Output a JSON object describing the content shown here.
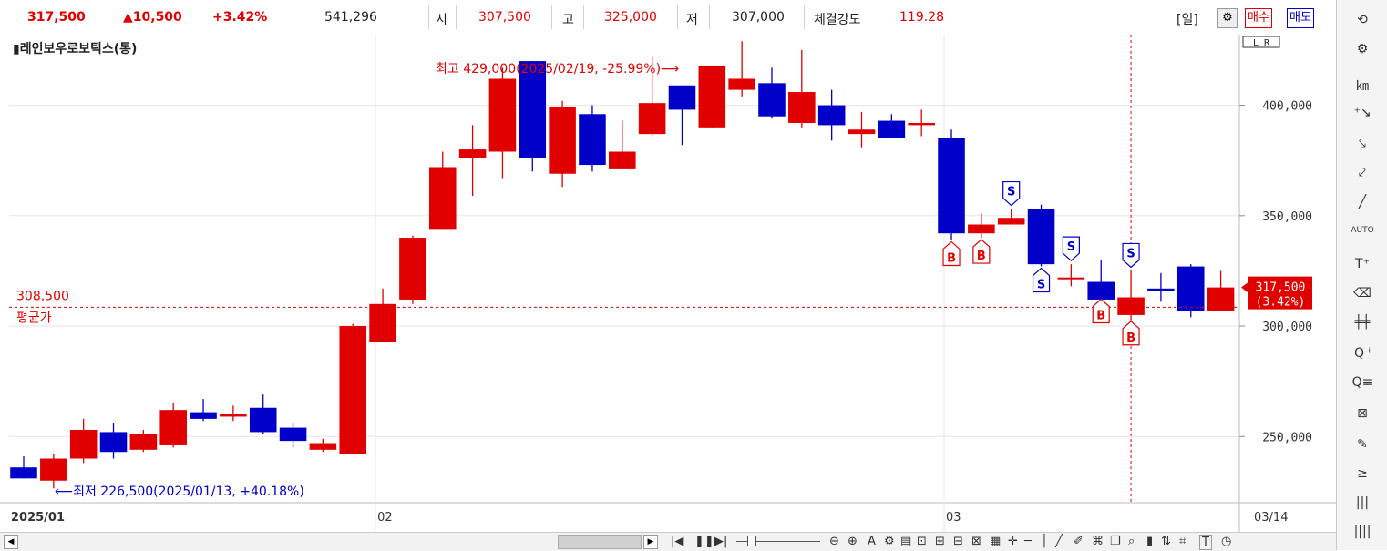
{
  "quote": {
    "price": "317,500",
    "change": "▲10,500",
    "change_pct": "+3.42%",
    "volume": "541,296",
    "open_label": "시",
    "open": "307,500",
    "high_label": "고",
    "high": "325,000",
    "low_label": "저",
    "low": "307,000",
    "strength_label": "체결강도",
    "strength": "119.28"
  },
  "toolbar": {
    "period": "[일]",
    "buy_label": "매수",
    "sell_label": "매도",
    "lr_label": "L R"
  },
  "chart_title": "▮레인보우로보틱스(통)",
  "colors": {
    "up": "#e00000",
    "down": "#0000c8",
    "accent_red": "#e00000"
  },
  "chart_data": {
    "type": "candlestick",
    "y_range": [
      220000,
      432000
    ],
    "y_ticks": [
      250000,
      300000,
      350000,
      400000
    ],
    "y_tick_labels": [
      "250,000",
      "300,000",
      "350,000",
      "400,000"
    ],
    "x_labels": [
      {
        "index": 0,
        "label": "2025/01"
      },
      {
        "index": 12,
        "label": "02"
      },
      {
        "index": 31,
        "label": "03"
      },
      {
        "index": 40,
        "label": "03/14"
      }
    ],
    "candles": [
      {
        "o": 236000,
        "h": 241000,
        "l": 231000,
        "c": 231000
      },
      {
        "o": 230000,
        "h": 242000,
        "l": 226500,
        "c": 240000
      },
      {
        "o": 240000,
        "h": 258000,
        "l": 238000,
        "c": 253000
      },
      {
        "o": 252000,
        "h": 256000,
        "l": 240000,
        "c": 243000
      },
      {
        "o": 244000,
        "h": 253000,
        "l": 243000,
        "c": 251000
      },
      {
        "o": 246000,
        "h": 265000,
        "l": 245000,
        "c": 262000
      },
      {
        "o": 261000,
        "h": 267000,
        "l": 257000,
        "c": 258000
      },
      {
        "o": 259000,
        "h": 264000,
        "l": 257000,
        "c": 260000
      },
      {
        "o": 263000,
        "h": 269000,
        "l": 251000,
        "c": 252000
      },
      {
        "o": 254000,
        "h": 256000,
        "l": 245000,
        "c": 248000
      },
      {
        "o": 244000,
        "h": 249000,
        "l": 243000,
        "c": 247000
      },
      {
        "o": 242000,
        "h": 301000,
        "l": 242000,
        "c": 300000
      },
      {
        "o": 293000,
        "h": 317000,
        "l": 293000,
        "c": 310000
      },
      {
        "o": 312000,
        "h": 341000,
        "l": 310000,
        "c": 340000
      },
      {
        "o": 344000,
        "h": 379000,
        "l": 344000,
        "c": 372000
      },
      {
        "o": 376000,
        "h": 391000,
        "l": 359000,
        "c": 380000
      },
      {
        "o": 379000,
        "h": 417000,
        "l": 367000,
        "c": 412000
      },
      {
        "o": 420000,
        "h": 420000,
        "l": 370000,
        "c": 376000
      },
      {
        "o": 369000,
        "h": 402000,
        "l": 363000,
        "c": 399000
      },
      {
        "o": 396000,
        "h": 400000,
        "l": 370000,
        "c": 373000
      },
      {
        "o": 371000,
        "h": 393000,
        "l": 371000,
        "c": 379000
      },
      {
        "o": 387000,
        "h": 422000,
        "l": 386000,
        "c": 401000
      },
      {
        "o": 409000,
        "h": 409000,
        "l": 382000,
        "c": 398000
      },
      {
        "o": 390000,
        "h": 418000,
        "l": 390000,
        "c": 418000
      },
      {
        "o": 407000,
        "h": 429000,
        "l": 404000,
        "c": 412000
      },
      {
        "o": 410000,
        "h": 417000,
        "l": 394000,
        "c": 395000
      },
      {
        "o": 392000,
        "h": 425000,
        "l": 390000,
        "c": 406000
      },
      {
        "o": 400000,
        "h": 407000,
        "l": 384000,
        "c": 391000
      },
      {
        "o": 387000,
        "h": 397000,
        "l": 381000,
        "c": 389000
      },
      {
        "o": 393000,
        "h": 396000,
        "l": 385000,
        "c": 385000
      },
      {
        "o": 391000,
        "h": 398000,
        "l": 386000,
        "c": 392000
      },
      {
        "o": 385000,
        "h": 389000,
        "l": 339000,
        "c": 342000
      },
      {
        "o": 342000,
        "h": 351000,
        "l": 340000,
        "c": 346000
      },
      {
        "o": 346000,
        "h": 353000,
        "l": 346000,
        "c": 349000
      },
      {
        "o": 353000,
        "h": 355000,
        "l": 327000,
        "c": 328000
      },
      {
        "o": 322000,
        "h": 328000,
        "l": 318000,
        "c": 322000
      },
      {
        "o": 320000,
        "h": 330000,
        "l": 313000,
        "c": 312000
      },
      {
        "o": 305000,
        "h": 325000,
        "l": 303000,
        "c": 313000
      },
      {
        "o": 317000,
        "h": 324000,
        "l": 311000,
        "c": 316000
      },
      {
        "o": 327000,
        "h": 328000,
        "l": 304000,
        "c": 307000
      },
      {
        "o": 307000,
        "h": 325000,
        "l": 307000,
        "c": 317500
      }
    ],
    "avg_price_line": 308500,
    "avg_price_label_value": "308,500",
    "avg_price_label_text": "평균가",
    "last_price_label": "317,500",
    "last_price_pct_label": "(3.42%)",
    "annotation_high": "최고 429,000(2025/02/19, -25.99%)⟶",
    "annotation_low": "⟵최저 226,500(2025/01/13, +40.18%)",
    "signals": [
      {
        "index": 31,
        "type": "B",
        "position": "below"
      },
      {
        "index": 32,
        "type": "B",
        "position": "below"
      },
      {
        "index": 33,
        "type": "S",
        "position": "above"
      },
      {
        "index": 34,
        "type": "S",
        "position": "below"
      },
      {
        "index": 35,
        "type": "S",
        "position": "above"
      },
      {
        "index": 36,
        "type": "B",
        "position": "below"
      },
      {
        "index": 37,
        "type": "S",
        "position": "above"
      },
      {
        "index": 37,
        "type": "B",
        "position": "below"
      }
    ],
    "cursor_index": 37
  },
  "right_tools": [
    "refresh-icon",
    "gear-icon",
    "chart-type-icon",
    "add-indicator-icon",
    "draw-down-icon",
    "draw-up-icon",
    "line-tool-icon",
    "auto-trend-icon",
    "text-tool-icon",
    "eraser-icon",
    "candle-icon",
    "zoom-info-icon",
    "zoom-list-icon",
    "zoom-chart-icon",
    "dollar-chart-icon",
    "fibonacci-icon",
    "vertical-lines-icon",
    "vertical-lines-2-icon"
  ]
}
